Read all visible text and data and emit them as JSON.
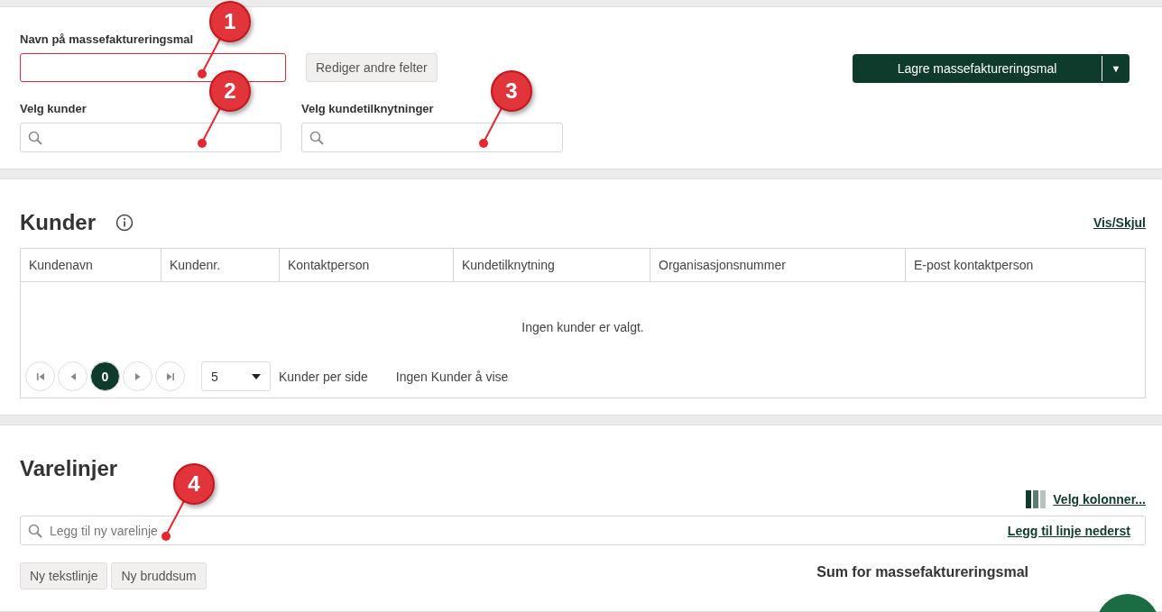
{
  "template": {
    "name_label": "Navn på massefaktureringsmal",
    "name_invalid": true,
    "name_callout": "1",
    "edit_button": "Rediger andre felter",
    "save_button": "Lagre massefaktureringsmal",
    "save_menu": "▼",
    "customer_search": {
      "label": "Velg kunder",
      "callout": "2"
    },
    "relation_search": {
      "label": "Velg kundetilknytninger",
      "callout": "3"
    }
  },
  "customers": {
    "title": "Kunder",
    "toggle_link": "Vis/Skjul",
    "columns": [
      "Kundenavn",
      "Kundenr.",
      "Kontaktperson",
      "Kundetilknytning",
      "Organisasjonsnummer",
      "E-post kontaktperson"
    ],
    "empty_message": "Ingen kunder er valgt.",
    "pagination": {
      "page": "0",
      "page_size": "5",
      "per_page_label": "Kunder per side",
      "status": "Ingen Kunder å vise"
    }
  },
  "item_lines": {
    "title": "Varelinjer",
    "columns_link": "Velg kolonner...",
    "search_placeholder": "Legg til ny varelinje",
    "callout": "4",
    "add_bottom_link": "Legg til linje nederst",
    "buttons": [
      "Ny tekstlinje",
      "Ny bruddsum"
    ],
    "sum_title": "Sum for massefaktureringsmal"
  }
}
